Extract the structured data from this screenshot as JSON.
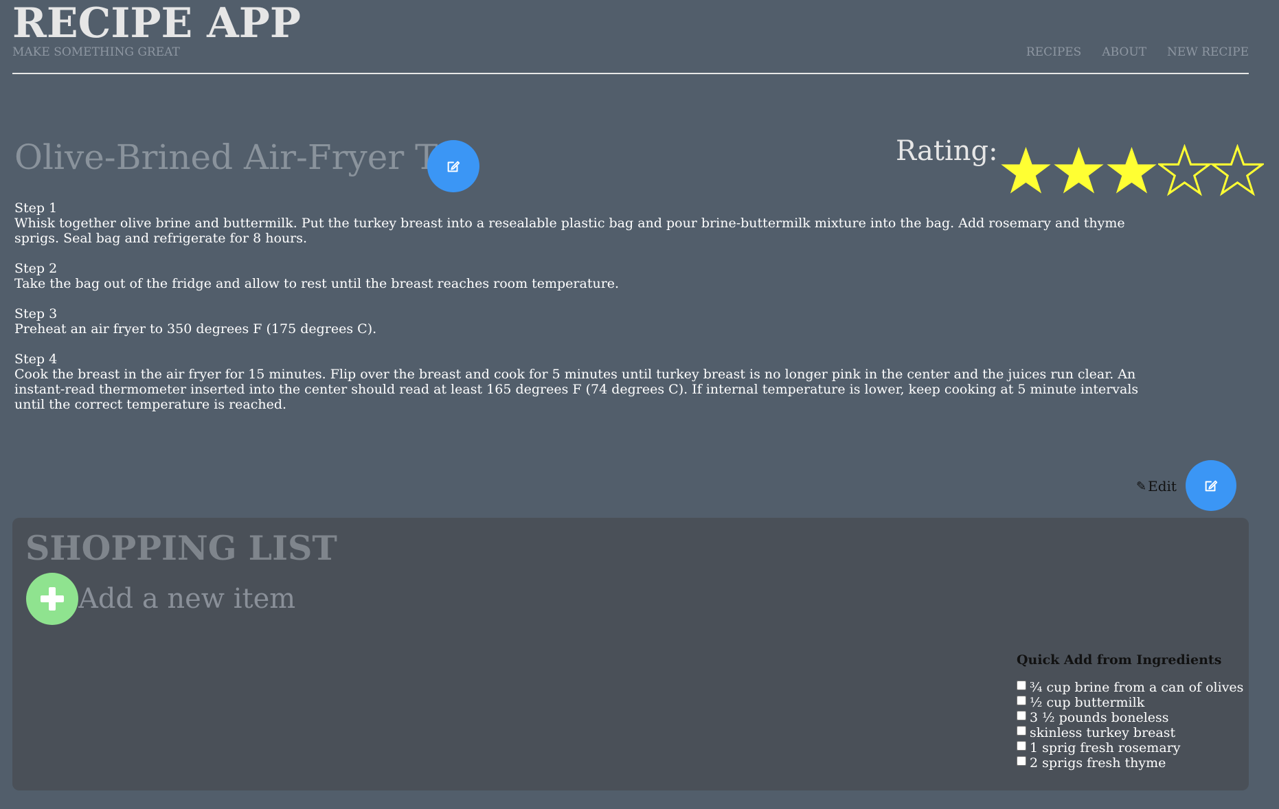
{
  "header": {
    "app_title": "RECIPE APP",
    "tagline": "MAKE SOMETHING GREAT",
    "nav": [
      {
        "label": "RECIPES"
      },
      {
        "label": "ABOUT"
      },
      {
        "label": "NEW RECIPE"
      }
    ]
  },
  "recipe": {
    "title": "Olive-Brined Air-Fryer Tu",
    "rating_label": "Rating:",
    "rating": 3,
    "rating_max": 5,
    "star_color": "#ffff33",
    "steps": [
      {
        "label": "Step 1",
        "text": "Whisk together olive brine and buttermilk. Put the turkey breast into a resealable plastic bag and pour brine-buttermilk mixture into the bag. Add rosemary and thyme sprigs. Seal bag and refrigerate for 8 hours."
      },
      {
        "label": "Step 2",
        "text": "Take the bag out of the fridge and allow to rest until the breast reaches room temperature."
      },
      {
        "label": "Step 3",
        "text": "Preheat an air fryer to 350 degrees F (175 degrees C)."
      },
      {
        "label": "Step 4",
        "text": "Cook the breast in the air fryer for 15 minutes. Flip over the breast and cook for 5 minutes until turkey breast is no longer pink in the center and the juices run clear. An instant-read thermometer inserted into the center should read at least 165 degrees F (74 degrees C). If internal temperature is lower, keep cooking at 5 minute intervals until the correct temperature is reached."
      }
    ],
    "edit_label": "Edit"
  },
  "shopping": {
    "title": "SHOPPING LIST",
    "add_placeholder": "Add a new item",
    "quick_add_title": "Quick Add from Ingredients",
    "ingredients": [
      {
        "label": "¾ cup brine from a can of olives",
        "checked": false
      },
      {
        "label": "½ cup buttermilk",
        "checked": false
      },
      {
        "label": "3 ½ pounds boneless",
        "checked": false
      },
      {
        "label": "skinless turkey breast",
        "checked": false
      },
      {
        "label": "1 sprig fresh rosemary",
        "checked": false
      },
      {
        "label": "2 sprigs fresh thyme",
        "checked": false
      }
    ]
  },
  "colors": {
    "background": "#525e6b",
    "accent_blue": "#3b96f5",
    "add_green": "#8fe38f",
    "panel": "#4a5058"
  },
  "icons": {
    "edit_fab": "edit-square-icon",
    "edit_link": "pencil-icon",
    "add": "plus-icon",
    "star_filled": "star-filled-icon",
    "star_empty": "star-outline-icon"
  }
}
